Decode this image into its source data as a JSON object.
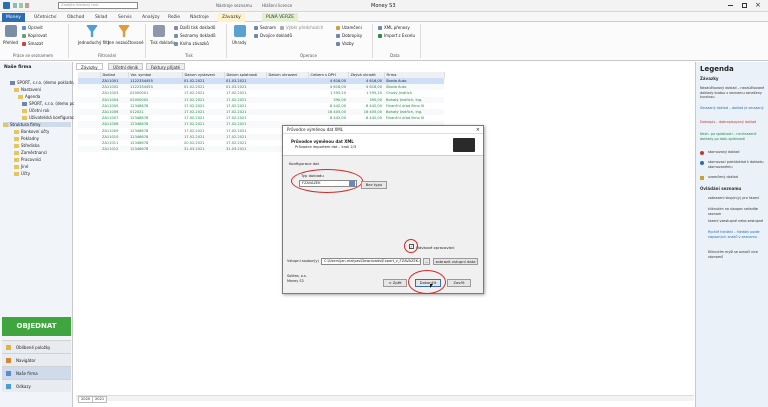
{
  "app_title": "Money S3",
  "search_placeholder": "Zadejte hledaný text",
  "context_header_1": "Nástroje seznamu",
  "context_header_2": "Hlášení licence",
  "ribbon_tabs": [
    "Money",
    "Účetnictví",
    "Obchod",
    "Sklad",
    "Servis",
    "Analýzy",
    "Režie",
    "Nástroje",
    "Závazky",
    "PLNÁ VERZE"
  ],
  "ribbon": {
    "print": "Přehled",
    "small1": [
      "Opravit",
      "Kopírovat",
      "Smazat"
    ],
    "group1_label": "Práce se seznamem",
    "filter_button": "Jednoduchý filtr",
    "advanced_filter": "Jen nezaúčtované",
    "group2_label": "Filtrování",
    "print_button": "Tisk dokladu",
    "print_small": [
      "Další tisk dokladů",
      "Seznamy dokladů",
      "Kniha závazků"
    ],
    "group3_label": "Tisk",
    "payments": "Úhrady",
    "op_small": [
      "Seznam",
      "Dvojice dokladů",
      "Vzory",
      "Pohyby",
      "Účetní doklady",
      "Účetní doklady"
    ],
    "op_extra": [
      "Výběr předchozích",
      "Uzamčení",
      "Dobropisy",
      "Vazby"
    ],
    "group4_label": "Operace",
    "data_small": [
      "XML přenosy",
      "Import z Excelu"
    ],
    "group5_label": "Data"
  },
  "left_panel": {
    "title": "Naše firma",
    "tree": [
      "SPORT, s.r.o. (demo pokladna)",
      "Nastavení",
      "Agenda",
      "SPORT, s.r.o. (demo pokladna)",
      "Účetní rok",
      "Uživatelská konfigurace",
      "Struktura firmy",
      "Bankovní účty",
      "Pokladny",
      "Střediska",
      "Zaměstnanci",
      "Pracovníci",
      "Jiné",
      "Účty",
      "Úkoly"
    ],
    "order_button": "OBJEDNAT",
    "nav": [
      "Oblíbené položky",
      "Navigátor",
      "Naše firma",
      "Odkazy"
    ]
  },
  "doc_tabs": [
    "Závazky",
    "Účetní deník",
    "Faktury přijaté"
  ],
  "table": {
    "columns": [
      "",
      "Doklad",
      "Var. symbol",
      "Datum vystavení",
      "Datum splatnosti",
      "Datum uhrazení",
      "Celkem s DPH",
      "Zbývá uhradit",
      "Firma"
    ],
    "rows": [
      [
        "",
        "ZA11001",
        "1122334455",
        "01.02.2021",
        "01.03.2021",
        "",
        "4 616,00",
        "4 616,00",
        "Škoda Auto"
      ],
      [
        "",
        "ZA11002",
        "1122334455",
        "01.02.2021",
        "01.03.2021",
        "",
        "4 616,00",
        "4 616,00",
        "Škoda Auto"
      ],
      [
        "",
        "ZA11003",
        "02000001",
        "17.02.2021",
        "17.02.2021",
        "",
        "1 595,20",
        "1 595,20",
        "Chudý Jindřich"
      ],
      [
        "",
        "ZA11004",
        "02000002",
        "17.02.2021",
        "17.02.2021",
        "",
        "390,00",
        "390,00",
        "Bohatý Jindřich, Ing."
      ],
      [
        "",
        "ZA11005",
        "12348678",
        "17.02.2021",
        "17.02.2021",
        "",
        "8 442,00",
        "8 442,00",
        "Finanční úřad Brno III"
      ],
      [
        "",
        "ZA11006",
        "012021",
        "17.02.2021",
        "17.02.2021",
        "",
        "16 405,00",
        "16 405,00",
        "Bohatý Jindřich, Ing."
      ],
      [
        "",
        "ZA11007",
        "12348678",
        "17.02.2021",
        "17.02.2021",
        "",
        "8 442,00",
        "8 442,00",
        "Finanční úřad Brno III"
      ],
      [
        "",
        "ZA11008",
        "12348678",
        "17.02.2021",
        "17.02.2021",
        "",
        "",
        "",
        ""
      ],
      [
        "",
        "ZA11009",
        "12348678",
        "17.02.2021",
        "17.02.2021",
        "",
        "",
        "",
        ""
      ],
      [
        "",
        "ZA11010",
        "12348678",
        "17.02.2021",
        "17.02.2021",
        "",
        "",
        "",
        ""
      ],
      [
        "",
        "ZA11011",
        "12348678",
        "20.02.2021",
        "17.02.2021",
        "",
        "",
        "",
        ""
      ],
      [
        "",
        "ZA11012",
        "12348678",
        "31.03.2021",
        "31.03.2021",
        "",
        "",
        "",
        ""
      ]
    ]
  },
  "legend": {
    "title": "Legenda",
    "section1": "Závazky",
    "items": [
      "Nezaúčtovaný doklad – nezaúčtované doklady budou v seznamu označeny kurzívou.",
      "Smazaný doklad – doklad je smazaný",
      "Dobropis – dobropisovaný doklad",
      "Nezh. po splatnosti – neuhrazené doklady po datu splatnosti",
      "stornovaný doklad",
      "stornovací protidoklad k dokladu stornovanému",
      "uzamčený doklad"
    ],
    "section2": "Ovládání seznamu",
    "items2": [
      "zobrazení skupin(y) pro řazení",
      "kliknutím na sloupec seřadíte seznam",
      "řazení vzestupné nebo sestupné",
      "Rychlé hledání – hledání podle napsaných znaků v seznamu",
      "Kliknutím myši se označí více záznamů"
    ]
  },
  "dialog": {
    "window_title": "Průvodce výměnou dat XML",
    "head_title": "Průvodce výměnou dat XML",
    "head_sub": "Průvodce importem dat – krok 2/3",
    "section": "Konfigurace dat",
    "doc_type_label": "Typ dokladu",
    "doc_type_value": "FZAVAZEK",
    "no_type_button": "Bez typu",
    "checkbox_label": "Dávkové zpracování",
    "input_file_label": "Vstupní soubor(y)",
    "input_file_value": "C:\\Users\\jan.matyas\\Downloads\\Export_z_FZAVAZEK.xml",
    "browse": "...",
    "show_data_button": "zobrazit vstupní data",
    "company": "Solitea, a.s.",
    "product": "Money S3",
    "back_button": "< Zpět",
    "finish_button": "Dokončit",
    "cancel_button": "Zavřít"
  },
  "status": {
    "year_tabs": [
      "2020",
      "2021"
    ]
  }
}
